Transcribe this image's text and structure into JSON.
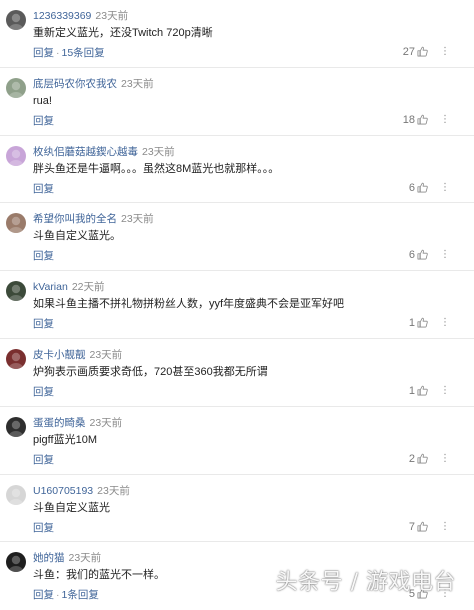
{
  "comments": [
    {
      "username": "1236339369",
      "time": "23天前",
      "text": "重新定义蓝光，还没Twitch 720p清晰",
      "reply_label": "回复",
      "separator": "·",
      "expand_label": "15条回复",
      "likes": "27",
      "avatar_color": "#5a5a5a"
    },
    {
      "username": "底层码农你农我农",
      "time": "23天前",
      "text": "rua!",
      "reply_label": "回复",
      "likes": "18",
      "avatar_color": "#8fa08a"
    },
    {
      "username": "枚纨佀蘑菇越鍥心越毒",
      "time": "23天前",
      "text": "胖头鱼还是牛逼啊。。。虽然这8M蓝光也就那样。。。",
      "reply_label": "回复",
      "likes": "6",
      "avatar_color": "#c8a5d8"
    },
    {
      "username": "希望你叫我的全名",
      "time": "23天前",
      "text": "斗鱼自定义蓝光。",
      "reply_label": "回复",
      "likes": "6",
      "avatar_color": "#9a7b6a"
    },
    {
      "username": "kVarian",
      "time": "22天前",
      "text": "如果斗鱼主播不拼礼物拼粉丝人数，yyf年度盛典不会是亚军好吧",
      "reply_label": "回复",
      "likes": "1",
      "avatar_color": "#3c4a3a"
    },
    {
      "username": "皮卡小靓靓",
      "time": "23天前",
      "text": "炉狗表示画质要求奇低，720甚至360我都无所谓",
      "reply_label": "回复",
      "likes": "1",
      "avatar_color": "#7a2f2f"
    },
    {
      "username": "蛋蛋的畸桑",
      "time": "23天前",
      "text": "pigff蓝光10M",
      "reply_label": "回复",
      "likes": "2",
      "avatar_color": "#2e2e2e"
    },
    {
      "username": "U160705193",
      "time": "23天前",
      "text": "斗鱼自定义蓝光",
      "reply_label": "回复",
      "likes": "7",
      "avatar_color": "#d6d6d6"
    },
    {
      "username": "她的猫",
      "time": "23天前",
      "text": "斗鱼：我们的蓝光不一样。",
      "reply_label": "回复",
      "separator": "·",
      "expand_label": "1条回复",
      "likes": "5",
      "avatar_color": "#1e1e1e"
    }
  ],
  "more_glyph": "⋮",
  "watermark": "头条号 / 游戏电台"
}
